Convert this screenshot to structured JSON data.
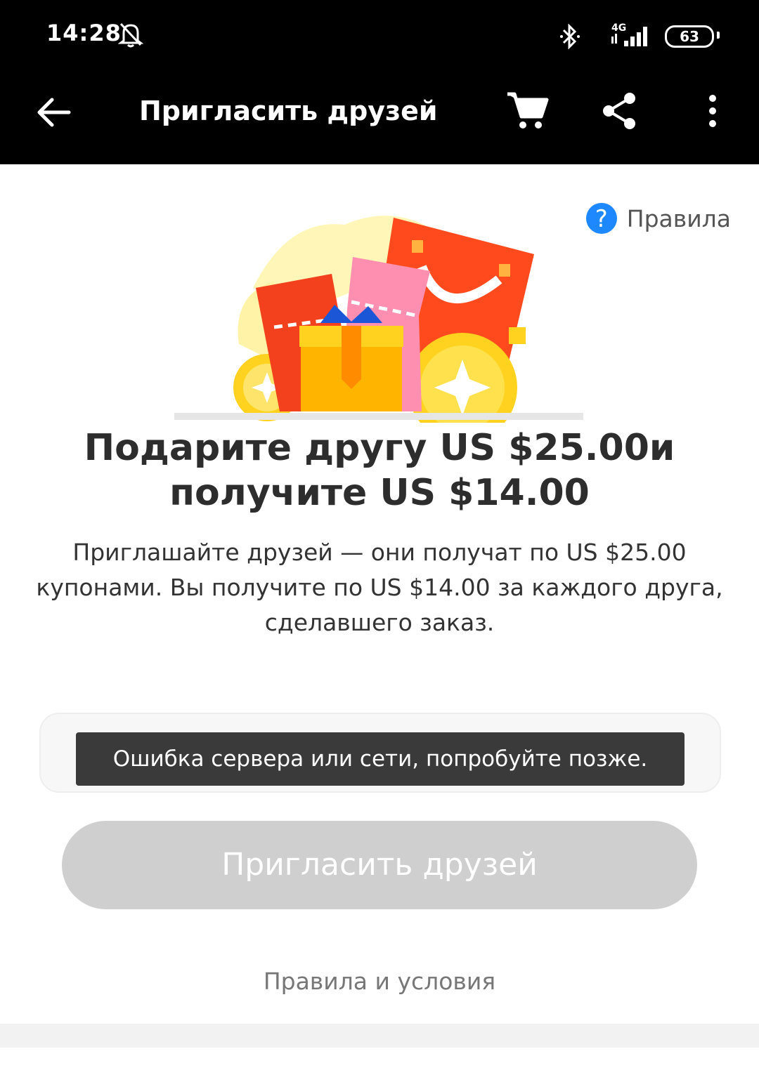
{
  "status_bar": {
    "time": "14:28",
    "network": "4G",
    "battery": "63"
  },
  "app_bar": {
    "title": "Пригласить друзей",
    "icons": [
      "back-arrow-icon",
      "cart-icon",
      "share-icon",
      "more-vert-icon"
    ]
  },
  "rules": {
    "icon": "?",
    "label": "Правила"
  },
  "promo": {
    "headline_line1": "Подарите другу US $25.00и",
    "headline_line2": "получите US $14.00",
    "description_line1": "Приглашайте друзей — они получат по US $25.00",
    "description_line2": "купонами. Вы получите по US $14.00 за каждого друга,",
    "description_line3": "сделавшего заказ."
  },
  "error": {
    "message": "Ошибка сервера или сети, попробуйте позже."
  },
  "actions": {
    "invite_label": "Пригласить друзей",
    "terms_label": "Правила и условия"
  },
  "colors": {
    "app_bar": "#000000",
    "help_icon": "#1e88ff",
    "button_disabled": "#cfcfcf",
    "toast": "#3a3a3a"
  }
}
